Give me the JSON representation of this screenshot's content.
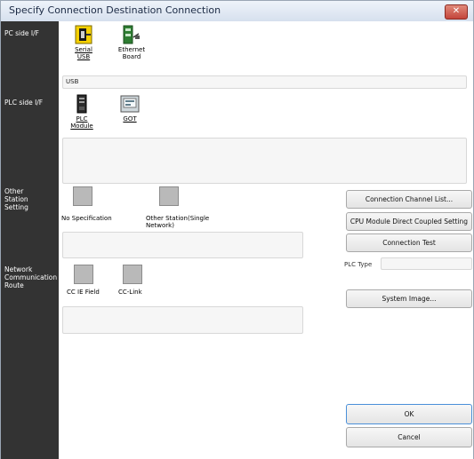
{
  "window": {
    "title": "Specify Connection Destination Connection",
    "close_label": "✕"
  },
  "sections": {
    "pc_side": "PC side I/F",
    "plc_side": "PLC side I/F",
    "other_station_lines": [
      "Other",
      "Station",
      "Setting"
    ],
    "network_lines": [
      "Network",
      "Communication",
      "Route"
    ]
  },
  "pc_side_options": [
    {
      "lines": [
        "Serial",
        "USB"
      ],
      "icon": "serial-usb-icon"
    },
    {
      "lines": [
        "Ethernet",
        "Board"
      ],
      "icon": "ethernet-board-icon"
    }
  ],
  "pc_side_detail": "USB",
  "plc_side_options": [
    {
      "lines": [
        "PLC",
        "Module"
      ],
      "icon": "plc-module-icon"
    },
    {
      "lines": [
        "GOT"
      ],
      "icon": "got-icon"
    }
  ],
  "other_station_options": [
    {
      "lines": [
        "No Specification"
      ]
    },
    {
      "lines": [
        "Other Station(Single",
        "Network)"
      ]
    }
  ],
  "network_route_options": [
    {
      "lines": [
        "CC IE Field"
      ]
    },
    {
      "lines": [
        "CC-Link"
      ]
    }
  ],
  "buttons": {
    "channel_list": "Connection Channel List...",
    "cpu_direct": "CPU Module Direct Coupled Setting",
    "connection_test": "Connection Test",
    "system_image": "System Image...",
    "ok": "OK",
    "cancel": "Cancel"
  },
  "plc_type": {
    "label": "PLC Type",
    "value": ""
  },
  "colors": {
    "left_panel": "#333333",
    "accent": "#4a90d9"
  }
}
